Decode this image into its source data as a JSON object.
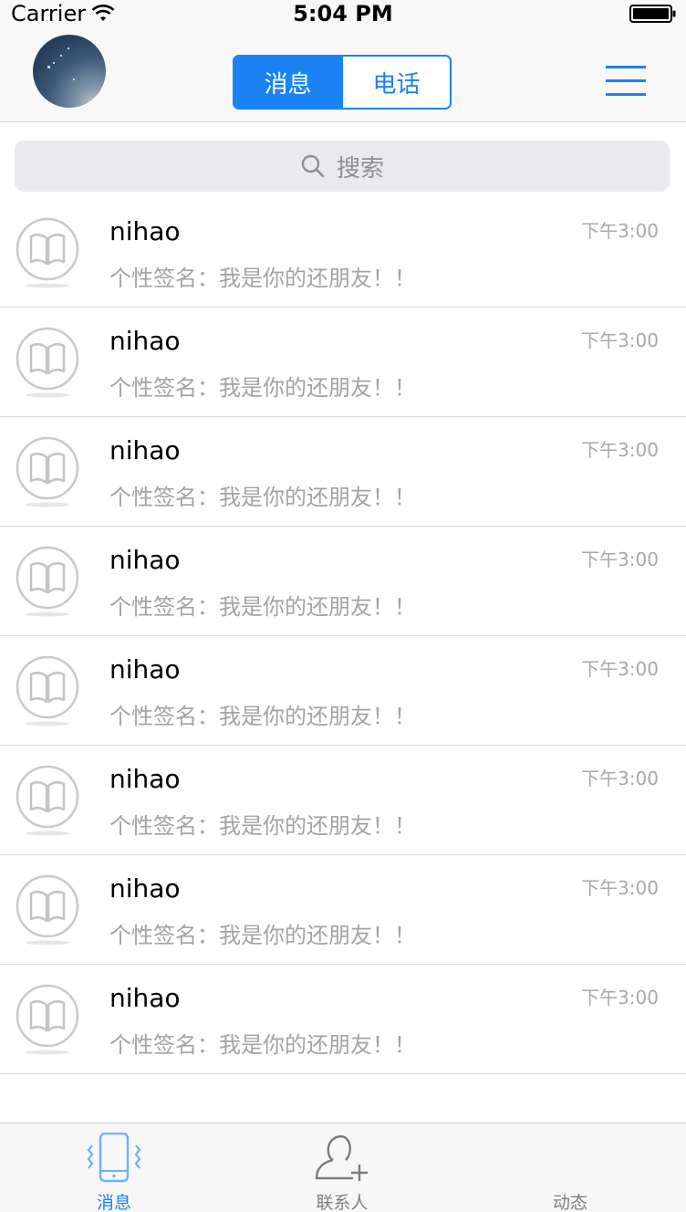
{
  "status_bar": {
    "carrier": "Carrier",
    "time": "5:04 PM"
  },
  "nav": {
    "segments": [
      {
        "label": "消息",
        "selected": true
      },
      {
        "label": "电话",
        "selected": false
      }
    ],
    "menu_icon": "hamburger-menu-icon"
  },
  "search": {
    "placeholder": "搜索",
    "icon": "search-icon"
  },
  "conversations": [
    {
      "name": "nihao",
      "signature": "个性签名：我是你的还朋友！！",
      "time": "下午3:00"
    },
    {
      "name": "nihao",
      "signature": "个性签名：我是你的还朋友！！",
      "time": "下午3:00"
    },
    {
      "name": "nihao",
      "signature": "个性签名：我是你的还朋友！！",
      "time": "下午3:00"
    },
    {
      "name": "nihao",
      "signature": "个性签名：我是你的还朋友！！",
      "time": "下午3:00"
    },
    {
      "name": "nihao",
      "signature": "个性签名：我是你的还朋友！！",
      "time": "下午3:00"
    },
    {
      "name": "nihao",
      "signature": "个性签名：我是你的还朋友！！",
      "time": "下午3:00"
    },
    {
      "name": "nihao",
      "signature": "个性签名：我是你的还朋友！！",
      "time": "下午3:00"
    },
    {
      "name": "nihao",
      "signature": "个性签名：我是你的还朋友！！",
      "time": "下午3:00"
    }
  ],
  "tab_bar": {
    "tabs": [
      {
        "label": "消息",
        "icon": "vibrating-phone-icon",
        "selected": true
      },
      {
        "label": "联系人",
        "icon": "add-contact-icon",
        "selected": false
      },
      {
        "label": "动态",
        "icon": "",
        "selected": false
      }
    ]
  },
  "colors": {
    "accent": "#1a82f5",
    "secondary_text": "#a3a3a3",
    "separator": "#d9d9dc"
  }
}
